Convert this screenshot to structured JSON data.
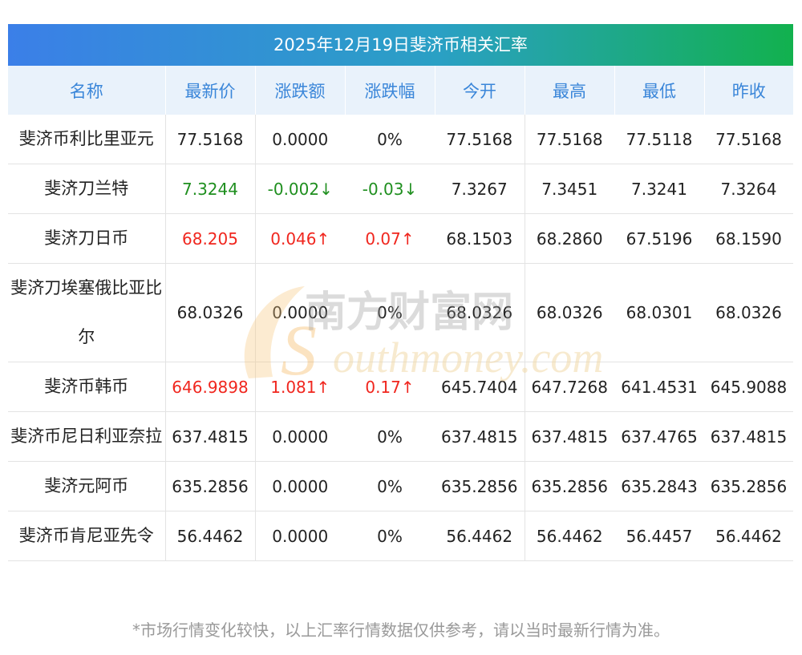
{
  "title": "2025年12月19日斐济币相关汇率",
  "headers": [
    "名称",
    "最新价",
    "涨跌额",
    "涨跌幅",
    "今开",
    "最高",
    "最低",
    "昨收"
  ],
  "rows": [
    {
      "name": "斐济币利比里亚元",
      "latest": "77.5168",
      "change": "0.0000",
      "pct": "0%",
      "open": "77.5168",
      "high": "77.5168",
      "low": "77.5118",
      "prev": "77.5168",
      "trend": "flat"
    },
    {
      "name": "斐济刀兰特",
      "latest": "7.3244",
      "change": "-0.002↓",
      "pct": "-0.03↓",
      "open": "7.3267",
      "high": "7.3451",
      "low": "7.3241",
      "prev": "7.3264",
      "trend": "down"
    },
    {
      "name": "斐济刀日币",
      "latest": "68.205",
      "change": "0.046↑",
      "pct": "0.07↑",
      "open": "68.1503",
      "high": "68.2860",
      "low": "67.5196",
      "prev": "68.1590",
      "trend": "up"
    },
    {
      "name": "斐济刀埃塞俄比亚比尔",
      "latest": "68.0326",
      "change": "0.0000",
      "pct": "0%",
      "open": "68.0326",
      "high": "68.0326",
      "low": "68.0301",
      "prev": "68.0326",
      "trend": "flat"
    },
    {
      "name": "斐济币韩币",
      "latest": "646.9898",
      "change": "1.081↑",
      "pct": "0.17↑",
      "open": "645.7404",
      "high": "647.7268",
      "low": "641.4531",
      "prev": "645.9088",
      "trend": "up"
    },
    {
      "name": "斐济币尼日利亚奈拉",
      "latest": "637.4815",
      "change": "0.0000",
      "pct": "0%",
      "open": "637.4815",
      "high": "637.4815",
      "low": "637.4765",
      "prev": "637.4815",
      "trend": "flat"
    },
    {
      "name": "斐济元阿币",
      "latest": "635.2856",
      "change": "0.0000",
      "pct": "0%",
      "open": "635.2856",
      "high": "635.2856",
      "low": "635.2843",
      "prev": "635.2856",
      "trend": "flat"
    },
    {
      "name": "斐济币肯尼亚先令",
      "latest": "56.4462",
      "change": "0.0000",
      "pct": "0%",
      "open": "56.4462",
      "high": "56.4462",
      "low": "56.4457",
      "prev": "56.4462",
      "trend": "flat"
    }
  ],
  "note": "*市场行情变化较快，以上汇率行情数据仅供参考，请以当时最新行情为准。",
  "watermark": {
    "cn": "南方财富网",
    "en": "outhmoney.com",
    "s": "S"
  },
  "colors": {
    "up": "#f0261e",
    "down": "#1f8f1f",
    "header_text": "#3a86d9",
    "header_bg": "#e9f2fb"
  }
}
